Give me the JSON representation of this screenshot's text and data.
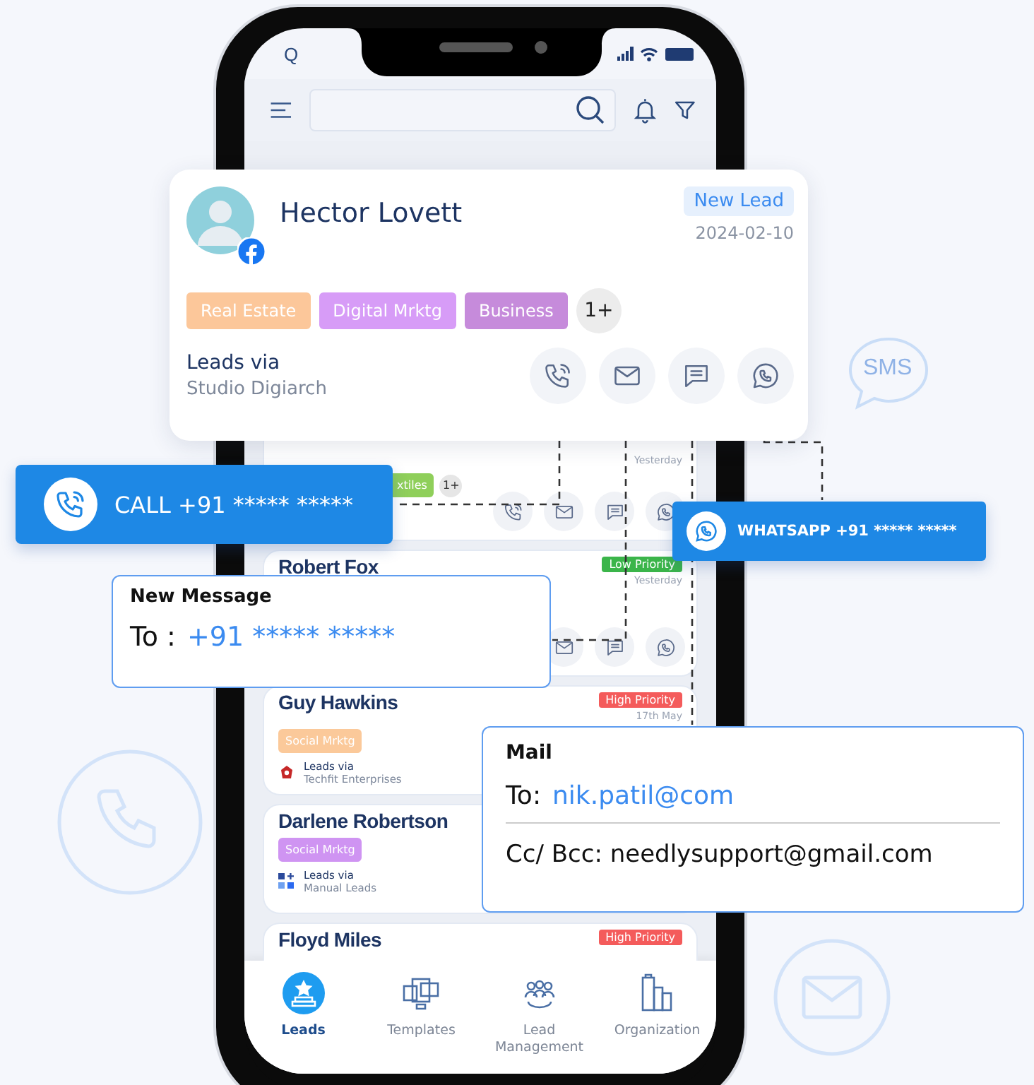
{
  "decor": {
    "sms_label": "SMS"
  },
  "status_bar": {
    "left": "Q"
  },
  "header": {
    "search": {
      "kind": "plain"
    }
  },
  "nav": [
    {
      "label": "Leads",
      "kind": "leads",
      "selected": true
    },
    {
      "label": "Templates",
      "kind": "templates",
      "selected": false
    },
    {
      "label": "Lead Management",
      "kind": "management",
      "selected": false
    },
    {
      "label": "Organization",
      "kind": "organization",
      "selected": false
    }
  ],
  "leads": [
    {
      "date": "Yesterday",
      "tags": [
        {
          "label": "xtiles",
          "color": "#8fcf5a"
        }
      ],
      "more": "1+",
      "actions": [
        {
          "kind": "call"
        },
        {
          "kind": "mail"
        },
        {
          "kind": "sms"
        },
        {
          "kind": "whatsapp"
        }
      ]
    },
    {
      "name": "Robert Fox",
      "priority": {
        "label": "Low Priority",
        "color": "#3bb54a"
      },
      "date": "Yesterday",
      "actions": [
        {
          "kind": "mail"
        },
        {
          "kind": "sms"
        },
        {
          "kind": "whatsapp"
        }
      ]
    },
    {
      "name": "Guy Hawkins",
      "priority": {
        "label": "High Priority",
        "color": "#f45b5b"
      },
      "date": "17th May",
      "tags": [
        {
          "label": "Social Mrktg",
          "color": "#fbc99a"
        }
      ],
      "via": {
        "title": "Leads via",
        "source": "Techfit Enterprises",
        "kind": "techfit"
      }
    },
    {
      "name": "Darlene Robertson",
      "tags": [
        {
          "label": "Social Mrktg",
          "color": "#cf94f2"
        }
      ],
      "via": {
        "title": "Leads via",
        "source": "Manual Leads",
        "kind": "manual"
      }
    },
    {
      "name": "Floyd Miles",
      "priority": {
        "label": "High Priority",
        "color": "#f45b5b"
      }
    }
  ],
  "lead_card": {
    "name": "Hector Lovett",
    "status": "New Lead",
    "date": "2024-02-10",
    "tags": [
      {
        "label": "Real Estate",
        "color": "#fcc79a"
      },
      {
        "label": "Digital Mrktg",
        "color": "#d79cf7"
      },
      {
        "label": "Business",
        "color": "#c68bdb"
      }
    ],
    "more": "1+",
    "via_title": "Leads via",
    "via_source": "Studio Digiarch",
    "actions": [
      {
        "kind": "call"
      },
      {
        "kind": "mail"
      },
      {
        "kind": "sms"
      },
      {
        "kind": "whatsapp"
      }
    ]
  },
  "call_banner": {
    "label": "CALL +91 ***** *****"
  },
  "whatsapp_banner": {
    "label": "WHATSAPP +91 ***** *****"
  },
  "message_popup": {
    "title": "New Message",
    "to_label": "To :",
    "to_value": "+91 ***** *****"
  },
  "mail_popup": {
    "title": "Mail",
    "to_label": "To:",
    "to_value": "nik.patil@com",
    "cc_line": "Cc/ Bcc: needlysupport@gmail.com"
  }
}
